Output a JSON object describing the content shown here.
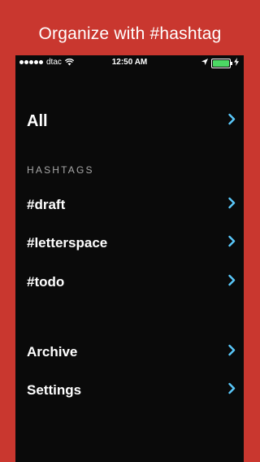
{
  "promo": {
    "title": "Organize with #hashtag"
  },
  "status_bar": {
    "carrier": "dtac",
    "time": "12:50 AM",
    "battery_level": 1.0
  },
  "menu": {
    "all_label": "All",
    "hashtags_header": "HASHTAGS",
    "hashtags": [
      {
        "label": "#draft"
      },
      {
        "label": "#letterspace"
      },
      {
        "label": "#todo"
      }
    ],
    "archive_label": "Archive",
    "settings_label": "Settings"
  },
  "colors": {
    "background": "#c9372f",
    "screen": "#0a0a0a",
    "chevron": "#5ac8fa",
    "battery": "#4cd964"
  },
  "icons": [
    "wifi-icon",
    "location-arrow-icon",
    "battery-icon",
    "charging-icon",
    "chevron-right-icon"
  ]
}
